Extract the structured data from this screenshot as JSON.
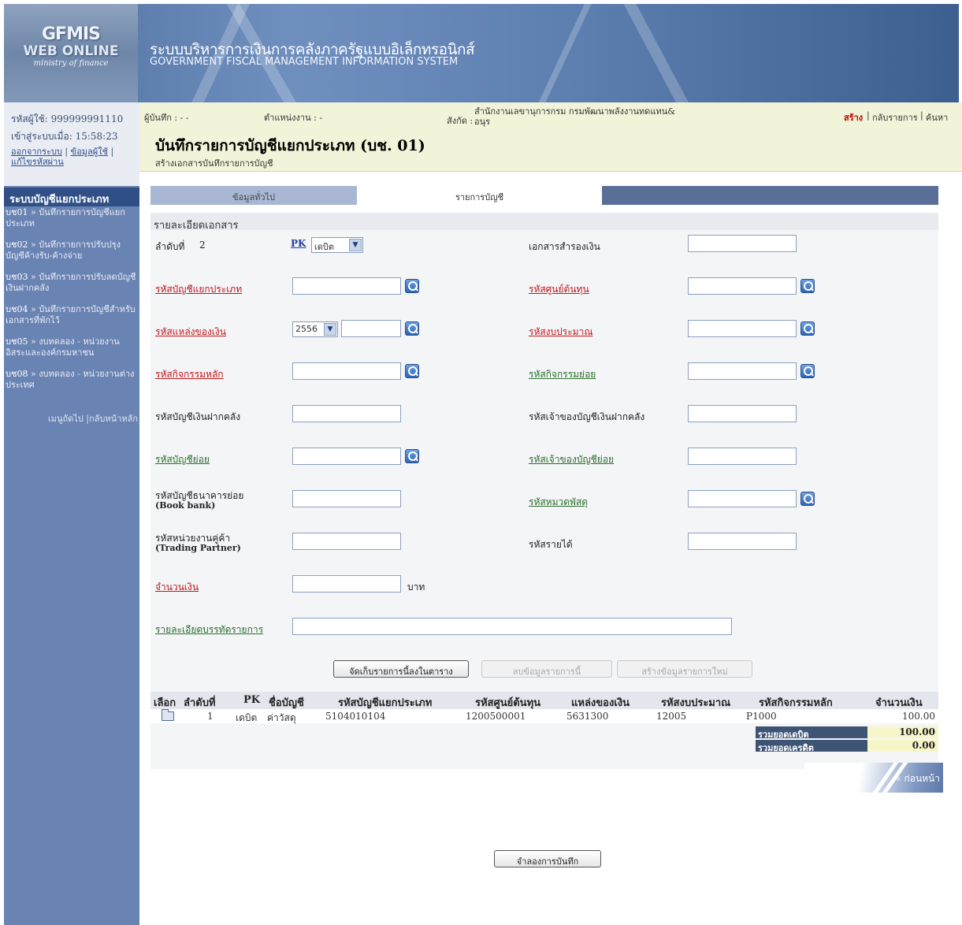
{
  "banner": {
    "logo_title": "GFMIS",
    "logo_sub": "WEB ONLINE",
    "logo_ministry": "ministry of finance",
    "system_name_th": "ระบบบริหารการเงินการคลังภาครัฐแบบอิเล็กทรอนิกส์",
    "system_name_en": "GOVERNMENT FISCAL MANAGEMENT INFORMATION SYSTEM"
  },
  "user": {
    "user_label": "รหัสผู้ใช้:",
    "user_id": "999999991110",
    "login_label": "เข้าสู่ระบบเมื่อ:",
    "login_time": "15:58:23",
    "logout": "ออกจากระบบ",
    "profile": "ข้อมูลผู้ใช้",
    "change_password": "แก้ไขรหัสผ่าน"
  },
  "sidebar": {
    "menu_title": "ระบบบัญชีแยกประเภท",
    "items": [
      {
        "code": "บช01",
        "label": "บันทึกรายการบัญชีแยกประเภท"
      },
      {
        "code": "บช02",
        "label": "บันทึกรายการปรับปรุงบัญชีค้างรับ-ค้างจ่าย"
      },
      {
        "code": "บช03",
        "label": "บันทึกรายการปรับลดบัญชีเงินฝากคลัง"
      },
      {
        "code": "บช04",
        "label": "บันทึกรายการบัญชีสำหรับเอกสารที่พักไว้"
      },
      {
        "code": "บช05",
        "label": "งบทดลอง - หน่วยงานอิสระและองค์กรมหาชน"
      },
      {
        "code": "บช08",
        "label": "งบทดลอง - หน่วยงานต่างประเทศ"
      }
    ],
    "next_menu": "เมนูถัดไป",
    "home": "กลับหน้าหลัก"
  },
  "info_bar": {
    "recorder_label": "ผู้บันทึก : - -",
    "position_label": "ตำแหน่งงาน : -",
    "affiliation_label": "สังกัด :",
    "affiliation_value_1": "สำนักงานเลขานุการกรม กรมพัฒนาพลังงานทดแทน&",
    "affiliation_value_2": "อนุร",
    "create": "สร้าง",
    "back_to_list": "กลับรายการ",
    "search": "ค้นหา"
  },
  "page": {
    "title": "บันทึกรายการบัญชีแยกประเภท (บช. 01)",
    "subtitle": "สร้างเอกสารบันทึกรายการบัญชี"
  },
  "tabs": {
    "general": "ข้อมูลทั่วไป",
    "items": "รายการบัญชี"
  },
  "form": {
    "section_title": "รายละเอียดเอกสาร",
    "seq_label": "ลำดับที่",
    "seq_value": "2",
    "pk_label": "PK",
    "pk_value": "เดบิต",
    "reserve_doc_label": "เอกสารสำรองเงิน",
    "gl_account_label": "รหัสบัญชีแยกประเภท",
    "cost_center_label": "รหัสศูนย์ต้นทุน",
    "fund_source_label": "รหัสแหล่งของเงิน",
    "fund_year": "2556",
    "budget_label": "รหัสงบประมาณ",
    "main_activity_label": "รหัสกิจกรรมหลัก",
    "sub_activity_label": "รหัสกิจกรรมย่อย",
    "deposit_account_label": "รหัสบัญชีเงินฝากคลัง",
    "deposit_owner_label": "รหัสเจ้าของบัญชีเงินฝากคลัง",
    "sub_account_label": "รหัสบัญชีย่อย",
    "sub_account_owner_label": "รหัสเจ้าของบัญชีย่อย",
    "bank_sub_account_label_1": "รหัสบัญชีธนาคารย่อย",
    "bank_sub_account_label_2": "(Book bank)",
    "supply_category_label": "รหัสหมวดพัสดุ",
    "trading_partner_label_1": "รหัสหน่วยงานคู่ค้า",
    "trading_partner_label_2": "(Trading Partner)",
    "revenue_label": "รหัสรายได้",
    "amount_label": "จำนวนเงิน",
    "amount_unit": "บาท",
    "line_detail_label": "รายละเอียดบรรทัดรายการ"
  },
  "buttons": {
    "save_to_table": "จัดเก็บรายการนี้ลงในตาราง",
    "delete_item": "ลบข้อมูลรายการนี้",
    "new_item": "สร้างข้อมูลรายการใหม่",
    "previous": "« ก่อนหน้า",
    "simulate": "จำลองการบันทึก"
  },
  "table": {
    "headers": [
      "เลือก",
      "ลำดับที่",
      "PK",
      "ชื่อบัญชี",
      "รหัสบัญชีแยกประเภท",
      "รหัสศูนย์ต้นทุน",
      "แหล่งของเงิน",
      "รหัสงบประมาณ",
      "รหัสกิจกรรมหลัก",
      "จำนวนเงิน"
    ],
    "rows": [
      {
        "seq": "1",
        "pk": "เดบิต",
        "account_name": "ค่าวัสดุ",
        "gl_account": "5104010104",
        "cost_center": "1200500001",
        "fund_source": "5631300",
        "budget": "12005",
        "main_activity": "P1000",
        "amount": "100.00"
      }
    ],
    "total_debit_label": "รวมยอดเดบิต",
    "total_debit": "100.00",
    "total_credit_label": "รวมยอดเครดิต",
    "total_credit": "0.00"
  },
  "colors": {
    "required_label": "#c0181c",
    "link_label": "#2b6e2b",
    "sidebar_bg": "#6983b3",
    "header_bar": "#2f4f86",
    "info_bar_bg": "#f2f4d9"
  }
}
